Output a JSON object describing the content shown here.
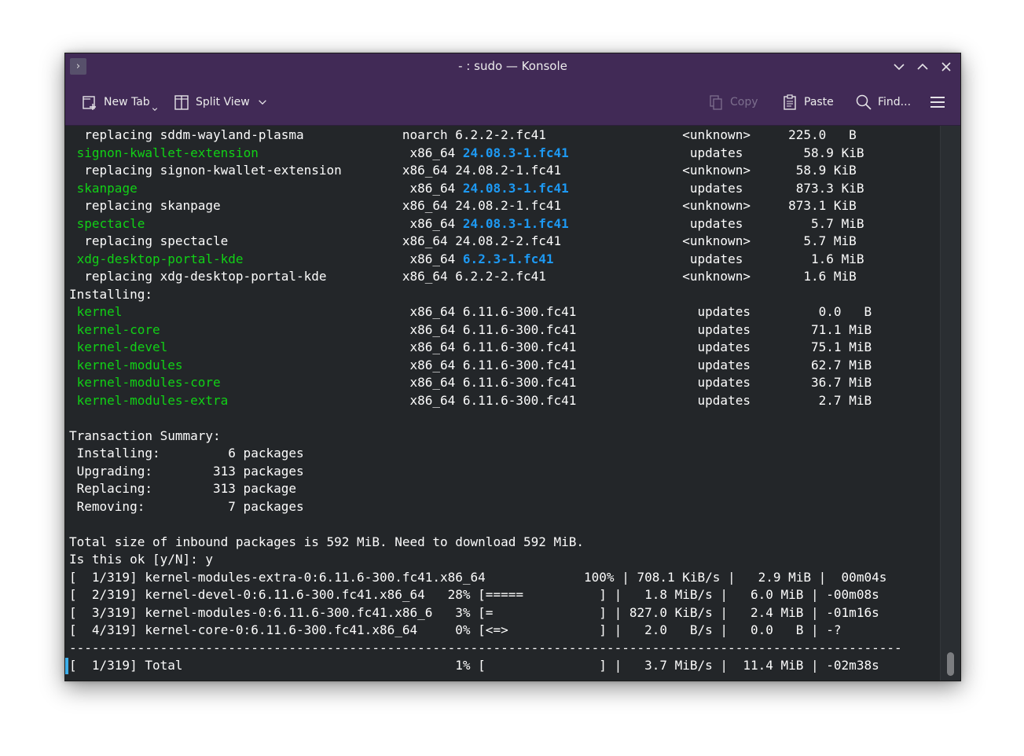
{
  "window": {
    "title": "- : sudo — Konsole",
    "menu_glyph": "›"
  },
  "toolbar": {
    "new_tab": "New Tab",
    "split_view": "Split View",
    "copy": "Copy",
    "paste": "Paste",
    "find": "Find..."
  },
  "terminal": {
    "lines": [
      [
        {
          "t": "  replacing sddm-wayland-plasma             noarch 6.2.2-2.fc41                  <unknown>     225.0   B"
        }
      ],
      [
        {
          "t": " "
        },
        {
          "t": "signon-kwallet-extension",
          "c": "g"
        },
        {
          "t": "                    x86_64 "
        },
        {
          "t": "24.08.3-1.fc41",
          "c": "b"
        },
        {
          "t": "                updates        58.9 KiB"
        }
      ],
      [
        {
          "t": "  replacing signon-kwallet-extension        x86_64 24.08.2-1.fc41                <unknown>      58.9 KiB"
        }
      ],
      [
        {
          "t": " "
        },
        {
          "t": "skanpage",
          "c": "g"
        },
        {
          "t": "                                    x86_64 "
        },
        {
          "t": "24.08.3-1.fc41",
          "c": "b"
        },
        {
          "t": "                updates       873.3 KiB"
        }
      ],
      [
        {
          "t": "  replacing skanpage                        x86_64 24.08.2-1.fc41                <unknown>     873.1 KiB"
        }
      ],
      [
        {
          "t": " "
        },
        {
          "t": "spectacle",
          "c": "g"
        },
        {
          "t": "                                   x86_64 "
        },
        {
          "t": "24.08.3-1.fc41",
          "c": "b"
        },
        {
          "t": "                updates         5.7 MiB"
        }
      ],
      [
        {
          "t": "  replacing spectacle                       x86_64 24.08.2-2.fc41                <unknown>       5.7 MiB"
        }
      ],
      [
        {
          "t": " "
        },
        {
          "t": "xdg-desktop-portal-kde",
          "c": "g"
        },
        {
          "t": "                      x86_64 "
        },
        {
          "t": "6.2.3-1.fc41",
          "c": "b"
        },
        {
          "t": "                  updates         1.6 MiB"
        }
      ],
      [
        {
          "t": "  replacing xdg-desktop-portal-kde          x86_64 6.2.2-2.fc41                  <unknown>       1.6 MiB"
        }
      ],
      [
        {
          "t": "Installing:"
        }
      ],
      [
        {
          "t": " "
        },
        {
          "t": "kernel",
          "c": "g"
        },
        {
          "t": "                                      x86_64 6.11.6-300.fc41                updates         0.0   B"
        }
      ],
      [
        {
          "t": " "
        },
        {
          "t": "kernel-core",
          "c": "g"
        },
        {
          "t": "                                 x86_64 6.11.6-300.fc41                updates        71.1 MiB"
        }
      ],
      [
        {
          "t": " "
        },
        {
          "t": "kernel-devel",
          "c": "g"
        },
        {
          "t": "                                x86_64 6.11.6-300.fc41                updates        75.1 MiB"
        }
      ],
      [
        {
          "t": " "
        },
        {
          "t": "kernel-modules",
          "c": "g"
        },
        {
          "t": "                              x86_64 6.11.6-300.fc41                updates        62.7 MiB"
        }
      ],
      [
        {
          "t": " "
        },
        {
          "t": "kernel-modules-core",
          "c": "g"
        },
        {
          "t": "                         x86_64 6.11.6-300.fc41                updates        36.7 MiB"
        }
      ],
      [
        {
          "t": " "
        },
        {
          "t": "kernel-modules-extra",
          "c": "g"
        },
        {
          "t": "                        x86_64 6.11.6-300.fc41                updates         2.7 MiB"
        }
      ],
      [
        {
          "t": ""
        }
      ],
      [
        {
          "t": "Transaction Summary:"
        }
      ],
      [
        {
          "t": " Installing:         6 packages"
        }
      ],
      [
        {
          "t": " Upgrading:        313 packages"
        }
      ],
      [
        {
          "t": " Replacing:        313 package"
        }
      ],
      [
        {
          "t": " Removing:           7 packages"
        }
      ],
      [
        {
          "t": ""
        }
      ],
      [
        {
          "t": "Total size of inbound packages is 592 MiB. Need to download 592 MiB."
        }
      ],
      [
        {
          "t": "Is this ok [y/N]: y"
        }
      ],
      [
        {
          "t": "[  1/319] kernel-modules-extra-0:6.11.6-300.fc41.x86_64             100% | 708.1 KiB/s |   2.9 MiB |  00m04s"
        }
      ],
      [
        {
          "t": "[  2/319] kernel-devel-0:6.11.6-300.fc41.x86_64   28% [=====          ] |   1.8 MiB/s |   6.0 MiB | -00m08s"
        }
      ],
      [
        {
          "t": "[  3/319] kernel-modules-0:6.11.6-300.fc41.x86_6   3% [=              ] | 827.0 KiB/s |   2.4 MiB | -01m16s"
        }
      ],
      [
        {
          "t": "[  4/319] kernel-core-0:6.11.6-300.fc41.x86_64     0% [<=>            ] |   2.0   B/s |   0.0   B | -?"
        }
      ],
      [
        {
          "t": "--------------------------------------------------------------------------------------------------------------"
        }
      ],
      [
        {
          "t": "[  1/319] Total                                    1% [               ] |   3.7 MiB/s |  11.4 MiB | -02m38s"
        }
      ]
    ]
  },
  "colors": {
    "titlebar": "#412a56",
    "terminal_bg": "#232629",
    "terminal_fg": "#fcfcfc",
    "package_green": "#11d116",
    "version_blue": "#1d99f3",
    "cursor": "#3daee9"
  }
}
